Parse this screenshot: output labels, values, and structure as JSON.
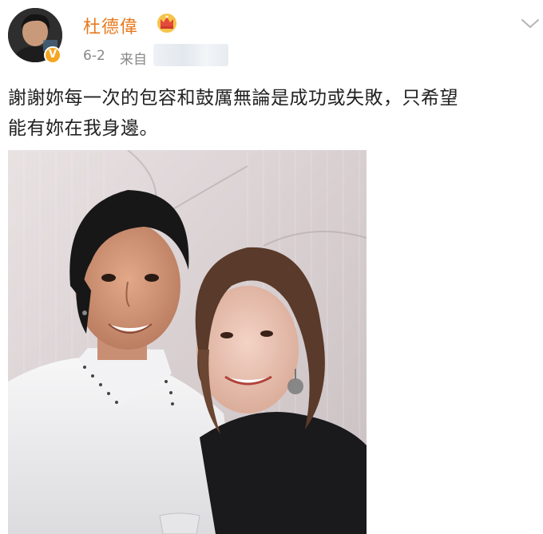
{
  "user": {
    "name": "杜德偉",
    "avatar_icon": "avatar-photo",
    "verified_icon": "verified-badge-icon",
    "verified_mark": "V",
    "crown_icon": "crown-icon"
  },
  "post": {
    "date": "6-2",
    "source_label": "来自",
    "text_line1": "謝謝妳每一次的包容和鼓厲無論是成功或失敗，只希望",
    "text_line2": "能有妳在我身邊。"
  },
  "toolbar": {
    "more_icon": "chevron-down-icon"
  },
  "colors": {
    "username": "#e8791d",
    "verified": "#f5a623",
    "meta_text": "#888888"
  }
}
